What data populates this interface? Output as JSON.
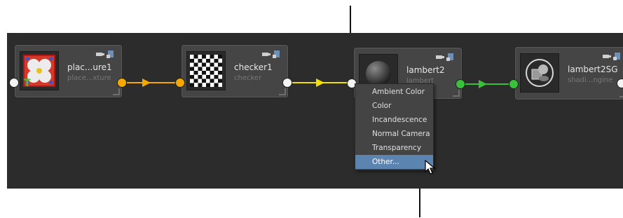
{
  "nodes": [
    {
      "id": "place2dTexture",
      "title": "plac...ure1",
      "subtitle": "place...xture"
    },
    {
      "id": "checker",
      "title": "checker1",
      "subtitle": "checker"
    },
    {
      "id": "lambert",
      "title": "lambert2",
      "subtitle": "lambert"
    },
    {
      "id": "shadingGroup",
      "title": "lambert2SG",
      "subtitle": "shadi...ngine"
    }
  ],
  "context_menu": {
    "items": [
      {
        "label": "Ambient Color"
      },
      {
        "label": "Color"
      },
      {
        "label": "Incandescence"
      },
      {
        "label": "Normal Camera"
      },
      {
        "label": "Transparency"
      },
      {
        "label": "Other...",
        "selected": true
      }
    ]
  },
  "colors": {
    "editor_bg": "#2c2c2c",
    "node_bg": "#454545",
    "connection_orange": "#f5a800",
    "connection_yellow": "#f4e000",
    "connection_green": "#3ac13a",
    "menu_highlight": "#5c84b0"
  },
  "icons": {
    "node_header": "camera-swatch-icons",
    "cursor": "mouse-pointer-icon"
  }
}
